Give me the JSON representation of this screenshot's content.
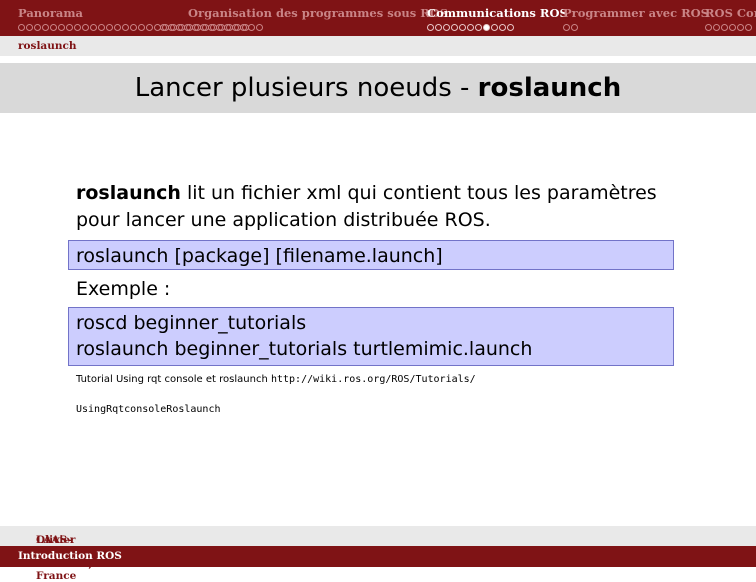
{
  "nav": {
    "sections": [
      {
        "label": "Panorama",
        "dots": 29,
        "active": false
      },
      {
        "label": "Organisation des programmes sous ROS",
        "dots": 0,
        "active": false
      },
      {
        "label": "Communications ROS",
        "dots": 11,
        "active": true,
        "current_dot": 8
      },
      {
        "label": "Programmer avec ROS",
        "dots": 2,
        "active": false
      },
      {
        "label": "ROS Con",
        "dots": 6,
        "active": false
      }
    ],
    "second_dot_group": 13
  },
  "subsection": "roslaunch",
  "title": {
    "main": "Lancer plusieurs noeuds - ",
    "bold": "roslaunch"
  },
  "content": {
    "intro_bold": "roslaunch",
    "intro_rest": " lit un fichier xml qui contient tous les paramètres pour lancer une application distribuée ROS.",
    "command": "roslaunch [package] [filename.launch]",
    "example_label": "Exemple :",
    "example_lines": [
      "roscd beginner_tutorials",
      "roslaunch beginner_tutorials turtlemimic.launch"
    ],
    "reference_text": "Tutorial  Using  rqt  console  et  roslaunch  ",
    "reference_url_1": "http://wiki.ros.org/ROS/Tutorials/",
    "reference_url_2": "UsingRqtconsoleRoslaunch"
  },
  "footer": {
    "author": "Olivier Stasse",
    "institution": "LAAS-CNRS, Toulouse, France",
    "short_title": "Introduction ROS"
  },
  "colors": {
    "bar": "#7f1315",
    "box_fill": "#cccdfe",
    "box_border": "#7273c8"
  }
}
